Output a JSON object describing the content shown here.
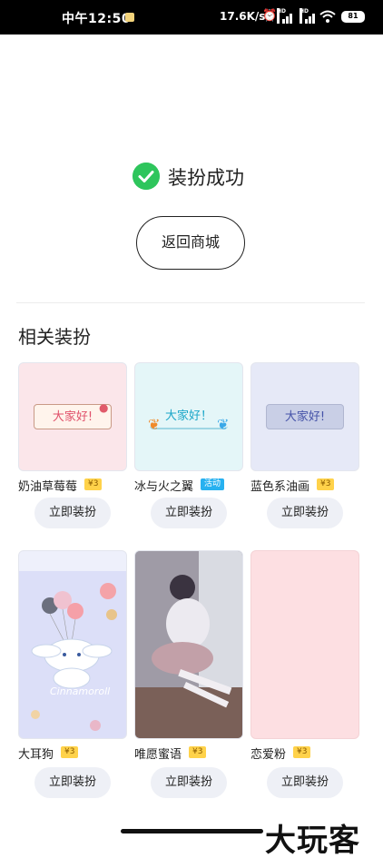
{
  "status_bar": {
    "time": "中午12:50",
    "network_speed": "17.6K/s",
    "battery": "81",
    "signal_labels": [
      "HD",
      "HD"
    ]
  },
  "success": {
    "message": "装扮成功"
  },
  "back_button": "返回商城",
  "section_title": "相关装扮",
  "items": [
    {
      "name": "奶油草莓莓",
      "price": "¥3",
      "badge_type": "price",
      "preview": "大家好!",
      "button": "立即装扮"
    },
    {
      "name": "冰与火之翼",
      "price": "活动",
      "badge_type": "event",
      "preview": "大家好！",
      "button": "立即装扮"
    },
    {
      "name": "蓝色系油画",
      "price": "¥3",
      "badge_type": "price",
      "preview": "大家好!",
      "button": "立即装扮"
    },
    {
      "name": "大耳狗",
      "price": "¥3",
      "badge_type": "price",
      "preview": "Cinnamoroll",
      "button": "立即装扮"
    },
    {
      "name": "唯愿蜜语",
      "price": "¥3",
      "badge_type": "price",
      "button": "立即装扮"
    },
    {
      "name": "恋爱粉",
      "price": "¥3",
      "badge_type": "price",
      "button": "立即装扮"
    }
  ],
  "watermark": "大玩客",
  "colors": {
    "accent_success": "#2ec55c",
    "price_badge": "#ffd24a",
    "event_badge": "#27b1f0",
    "button_bg": "#eef0f6"
  }
}
